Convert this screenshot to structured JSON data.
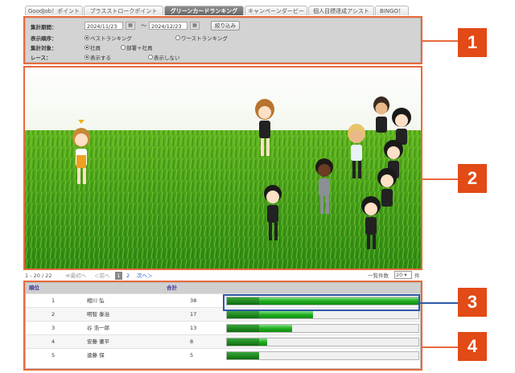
{
  "tabs": [
    {
      "label": "GoodJob！ポイント"
    },
    {
      "label": "プラスストロークポイント"
    },
    {
      "label": "グリーンカードランキング",
      "active": true
    },
    {
      "label": "キャンペーンダービー"
    },
    {
      "label": "個人目標達成アシスト"
    },
    {
      "label": "BINGO！"
    }
  ],
  "filter": {
    "period_label": "集計期間：",
    "date_from": "2024/11/23",
    "date_sep": "〜",
    "date_to": "2024/12/23",
    "submit_label": "絞り込み",
    "order_label": "表示順序：",
    "order_options": [
      "ベストランキング",
      "ワーストランキング"
    ],
    "target_label": "集計対象：",
    "target_options": [
      "社員",
      "部署＋社員"
    ],
    "race_label": "レース：",
    "race_options": [
      "表示する",
      "表示しない"
    ]
  },
  "pager": {
    "range": "1 - 20 / 22",
    "first": "≪最初へ",
    "prev": "＜前へ",
    "pages": [
      "1",
      "2"
    ],
    "next": "次へ＞",
    "per_page_label": "一覧件数",
    "per_page_value": "20",
    "per_page_unit": "件"
  },
  "table": {
    "col_rank": "順位",
    "col_total": "合計",
    "rows": [
      {
        "rank": "1",
        "name": "相川 弘",
        "total": "38",
        "fill": 1.0
      },
      {
        "rank": "2",
        "name": "明智 泰治",
        "total": "17",
        "fill": 0.45
      },
      {
        "rank": "3",
        "name": "谷 浩一郎",
        "total": "13",
        "fill": 0.34
      },
      {
        "rank": "4",
        "name": "安藤 徹平",
        "total": "8",
        "fill": 0.21
      },
      {
        "rank": "5",
        "name": "遠藤 保",
        "total": "5",
        "fill": 0.13
      }
    ]
  },
  "callouts": [
    "1",
    "2",
    "3",
    "4"
  ],
  "colors": {
    "callout": "#e24a16",
    "frame": "#e86a3c",
    "highlight": "#2f58a8",
    "bar": "#1fae1f"
  }
}
